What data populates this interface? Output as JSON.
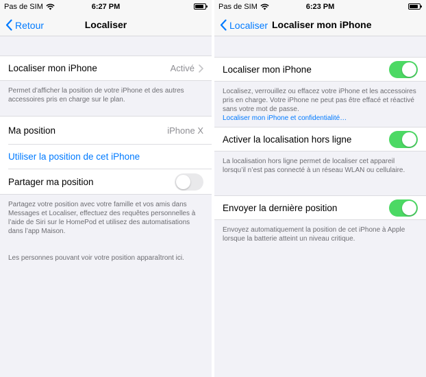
{
  "left": {
    "status": {
      "carrier": "Pas de SIM",
      "time": "6:27 PM"
    },
    "nav": {
      "back": "Retour",
      "title": "Localiser"
    },
    "group1": {
      "label": "Localiser mon iPhone",
      "value": "Activé"
    },
    "footer1": "Permet d’afficher la position de votre iPhone et des autres accessoires pris en charge sur le plan.",
    "group2": {
      "position_label": "Ma position",
      "position_value": "iPhone X",
      "use_link": "Utiliser la position de cet iPhone",
      "share_label": "Partager ma position",
      "share_on": false
    },
    "footer2a": "Partagez votre position avec votre famille et vos amis dans Messages et Localiser, effectuez des requêtes personnelles à l’aide de Siri sur le HomePod et utilisez des automatisations dans l’app Maison.",
    "footer2b": "Les personnes pouvant voir votre position apparaîtront ici."
  },
  "right": {
    "status": {
      "carrier": "Pas de SIM",
      "time": "6:23 PM"
    },
    "nav": {
      "back": "Localiser",
      "title": "Localiser mon iPhone"
    },
    "cell1": {
      "label": "Localiser mon iPhone",
      "on": true
    },
    "footer1": "Localisez, verrouillez ou effacez votre iPhone et les accessoires pris en charge. Votre iPhone ne peut pas être effacé et réactivé sans votre mot de passe.",
    "footer1_link": "Localiser mon iPhone et confidentialité…",
    "cell2": {
      "label": "Activer la localisation hors ligne",
      "on": true
    },
    "footer2": "La localisation hors ligne permet de localiser cet appareil lorsqu’il n’est pas connecté à un réseau WLAN ou cellulaire.",
    "cell3": {
      "label": "Envoyer la dernière position",
      "on": true
    },
    "footer3": "Envoyez automatiquement la position de cet iPhone à Apple lorsque la batterie atteint un niveau critique."
  },
  "colors": {
    "accent": "#007aff",
    "toggle_on": "#4cd964",
    "background": "#f2f2f7"
  }
}
